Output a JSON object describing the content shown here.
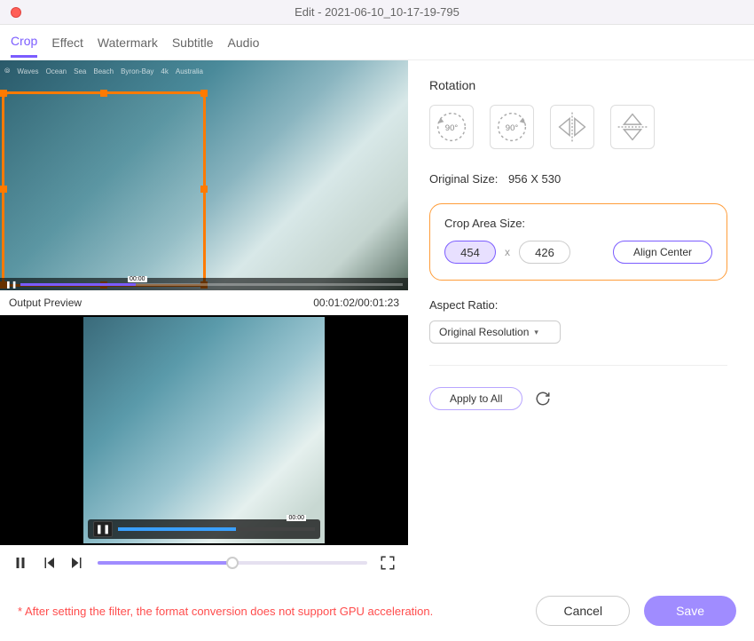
{
  "window": {
    "title": "Edit - 2021-06-10_10-17-19-795"
  },
  "tabs": {
    "crop": "Crop",
    "effect": "Effect",
    "watermark": "Watermark",
    "subtitle": "Subtitle",
    "audio": "Audio",
    "active": "crop"
  },
  "preview": {
    "metaTags": [
      "Waves",
      "Ocean",
      "Sea",
      "Beach",
      "Byron-Bay",
      "4k",
      "Australia"
    ],
    "cropTime": "00:00",
    "outputLabel": "Output Preview",
    "timecode": "00:01:02/00:01:23",
    "innerTime": "00:00"
  },
  "rotation": {
    "label": "Rotation",
    "ccw90": "90°",
    "cw90": "90°"
  },
  "originalSize": {
    "label": "Original Size:",
    "value": "956 X 530"
  },
  "cropArea": {
    "label": "Crop Area Size:",
    "width": "454",
    "height": "426",
    "sep": "x",
    "alignCenter": "Align Center"
  },
  "aspect": {
    "label": "Aspect Ratio:",
    "value": "Original Resolution"
  },
  "apply": {
    "label": "Apply to All"
  },
  "footer": {
    "note": "* After setting the filter, the format conversion does not support GPU acceleration.",
    "cancel": "Cancel",
    "save": "Save"
  }
}
